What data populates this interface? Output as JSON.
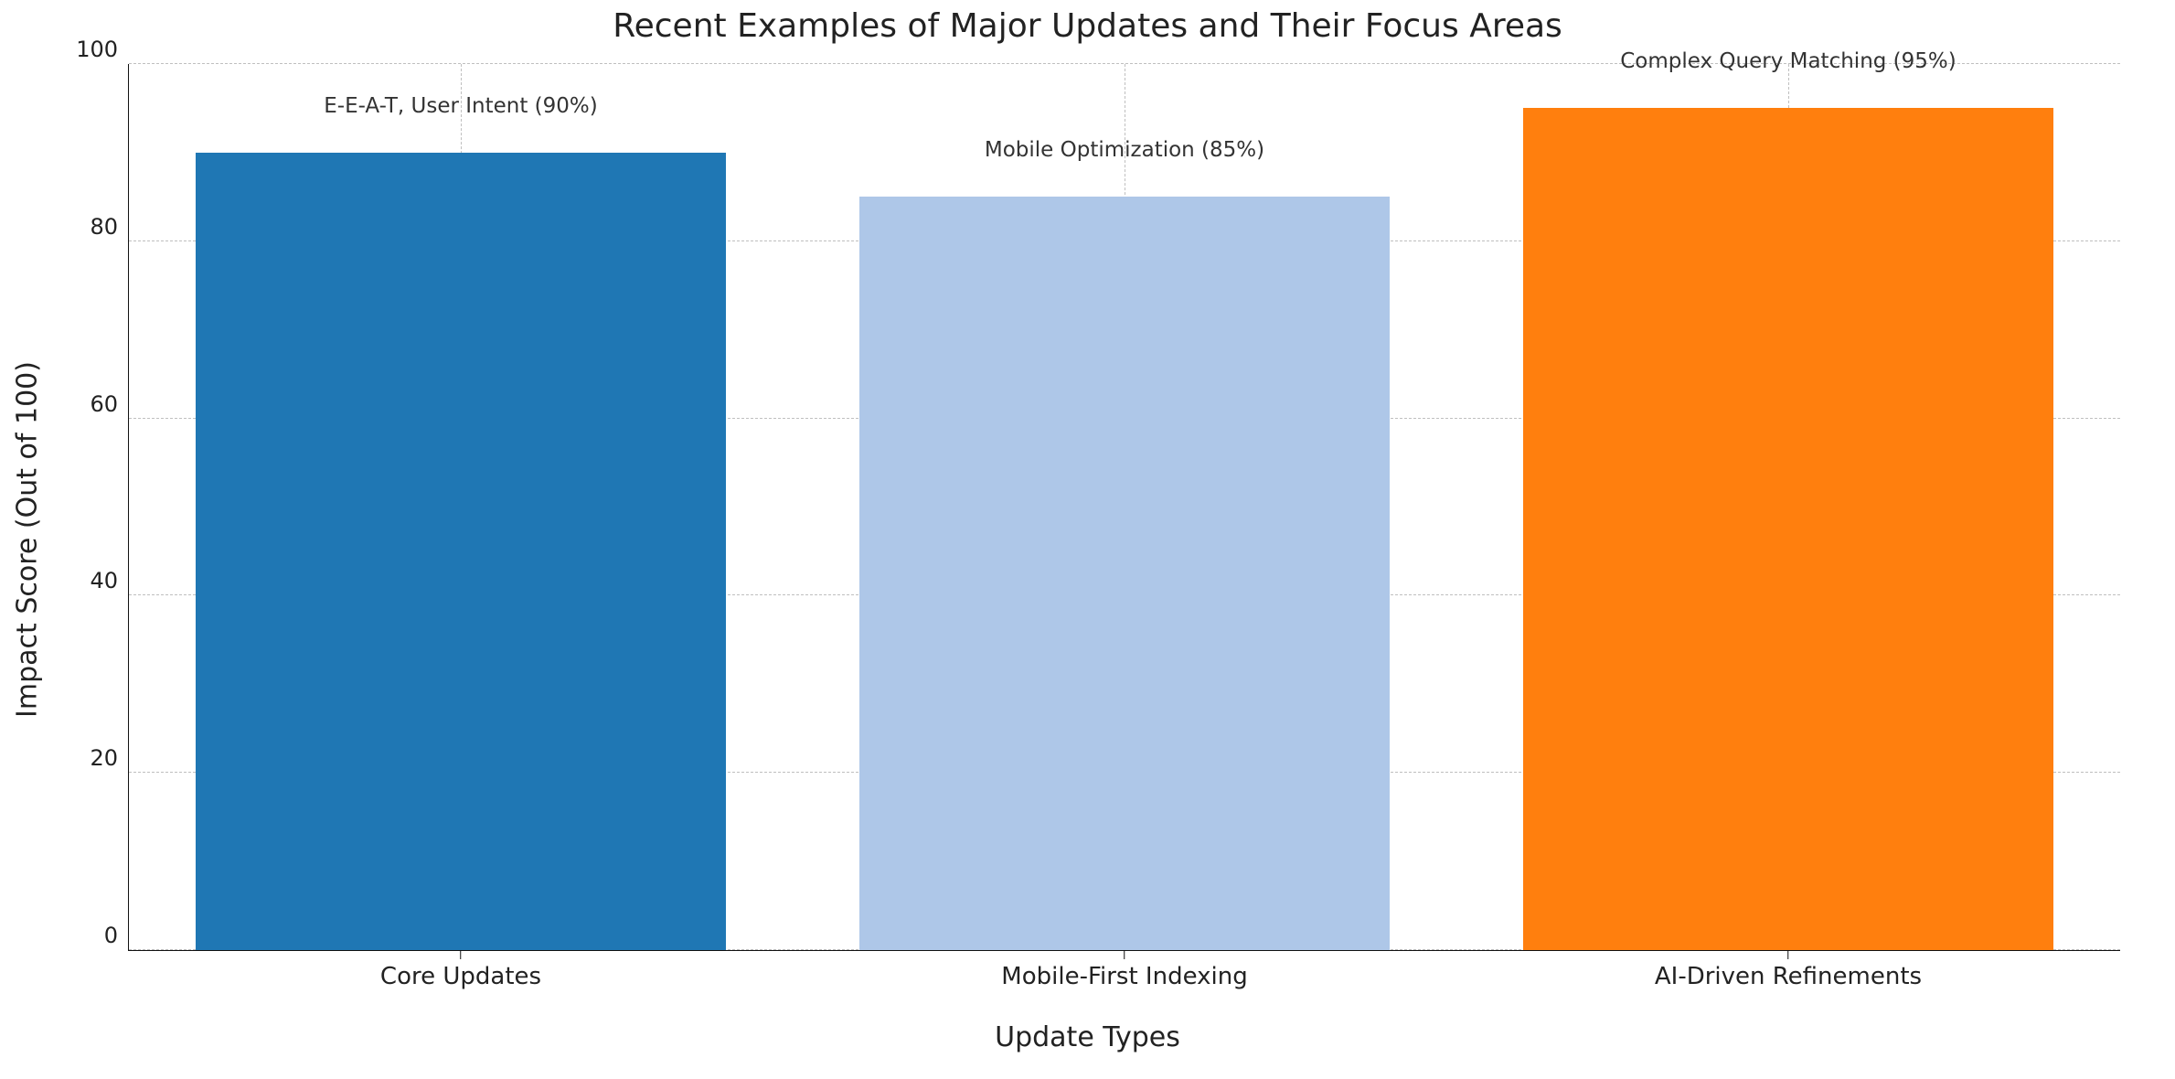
{
  "chart_data": {
    "type": "bar",
    "title": "Recent Examples of Major Updates and Their Focus Areas",
    "xlabel": "Update Types",
    "ylabel": "Impact Score (Out of 100)",
    "ylim": [
      0,
      100
    ],
    "yticks": [
      0,
      20,
      40,
      60,
      80,
      100
    ],
    "categories": [
      "Core Updates",
      "Mobile-First Indexing",
      "AI-Driven Refinements"
    ],
    "values": [
      90,
      85,
      95
    ],
    "bar_annotations": [
      "E-E-A-T, User Intent (90%)",
      "Mobile Optimization (85%)",
      "Complex Query Matching (95%)"
    ],
    "colors": [
      "#1f77b4",
      "#aec7e8",
      "#ff7f0e"
    ],
    "grid": true
  }
}
